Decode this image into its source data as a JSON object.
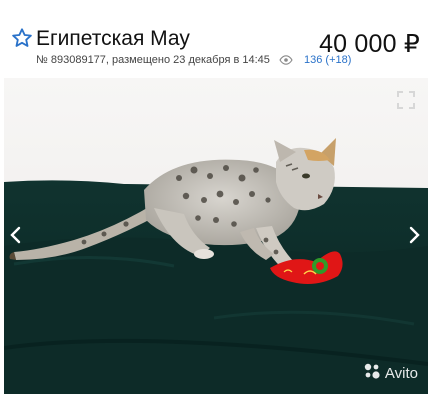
{
  "listing": {
    "title": "Египетская Мау",
    "price": "40 000 ₽",
    "meta": "№ 893089177, размещено 23 декабря в 14:45",
    "views": "136 (+18)"
  },
  "gallery": {
    "watermark": "Avito",
    "colors": {
      "wall": "#f3f2f1",
      "sofa": "#0f2f2b",
      "toy_red": "#e01616",
      "toy_green": "#2f9a2a"
    }
  },
  "icons": [
    "star-outline-icon",
    "eye-icon",
    "expand-icon",
    "chevron-left-icon",
    "chevron-right-icon",
    "avito-logo-icon"
  ]
}
